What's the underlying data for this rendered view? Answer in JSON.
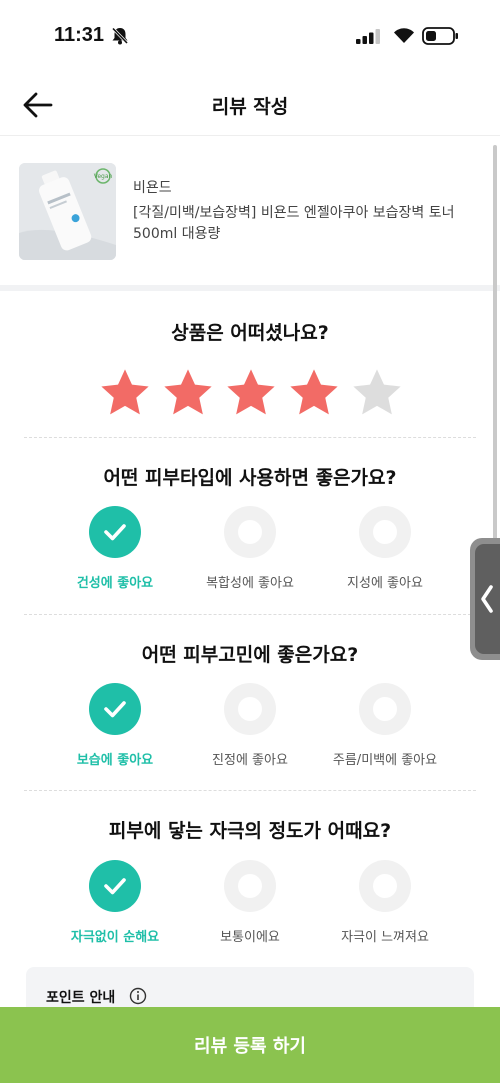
{
  "status_bar": {
    "time": "11:31"
  },
  "header": {
    "title": "리뷰 작성"
  },
  "product": {
    "brand": "비욘드",
    "name": "[각질/미백/보습장벽] 비욘드 엔젤아쿠아 보습장벽 토너 500ml 대용량",
    "badge": "Vegan"
  },
  "rating": {
    "question": "상품은 어떠셨나요?",
    "value": 4,
    "max": 5,
    "filled_color": "#f26b66",
    "empty_color": "#dddddd"
  },
  "skin_type": {
    "question": "어떤 피부타입에 사용하면 좋은가요?",
    "options": [
      "건성에 좋아요",
      "복합성에 좋아요",
      "지성에 좋아요"
    ],
    "selected": 0
  },
  "skin_concern": {
    "question": "어떤 피부고민에 좋은가요?",
    "options": [
      "보습에 좋아요",
      "진정에 좋아요",
      "주름/미백에 좋아요"
    ],
    "selected": 0
  },
  "irritation": {
    "question": "피부에 닿는 자극의 정도가 어때요?",
    "options": [
      "자극없이 순해요",
      "보통이에요",
      "자극이 느껴져요"
    ],
    "selected": 0
  },
  "points": {
    "title": "포인트 안내"
  },
  "submit": {
    "label": "리뷰 등록 하기"
  },
  "colors": {
    "accent": "#1fbfa8",
    "submit_bg": "#8bc34f"
  }
}
